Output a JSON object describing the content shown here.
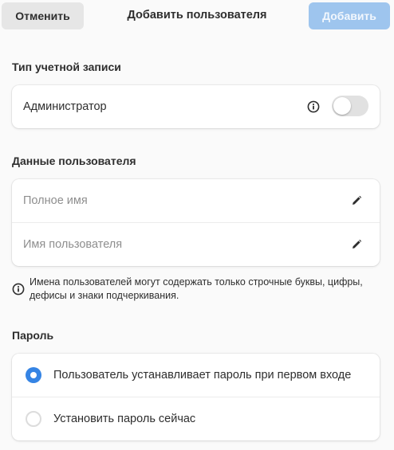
{
  "header": {
    "cancel_label": "Отменить",
    "title": "Добавить пользователя",
    "add_label": "Добавить"
  },
  "account_type": {
    "section_title": "Тип учетной записи",
    "admin_label": "Администратор",
    "admin_toggle_on": false
  },
  "user_data": {
    "section_title": "Данные пользователя",
    "full_name_placeholder": "Полное имя",
    "username_placeholder": "Имя пользователя",
    "hint": "Имена пользователей могут содержать только строчные буквы, цифры, дефисы и знаки подчеркивания."
  },
  "password": {
    "section_title": "Пароль",
    "options": [
      {
        "label": "Пользователь устанавливает пароль при первом входе",
        "selected": true
      },
      {
        "label": "Установить пароль сейчас",
        "selected": false
      }
    ]
  },
  "colors": {
    "accent": "#3584e4",
    "add_button_disabled_bg": "#9ec5ee",
    "cancel_button_bg": "#e6e6e6",
    "toggle_off_bg": "#e1e1e1"
  },
  "icons": [
    "info-icon",
    "pencil-icon",
    "radio-selected",
    "radio-unselected"
  ]
}
